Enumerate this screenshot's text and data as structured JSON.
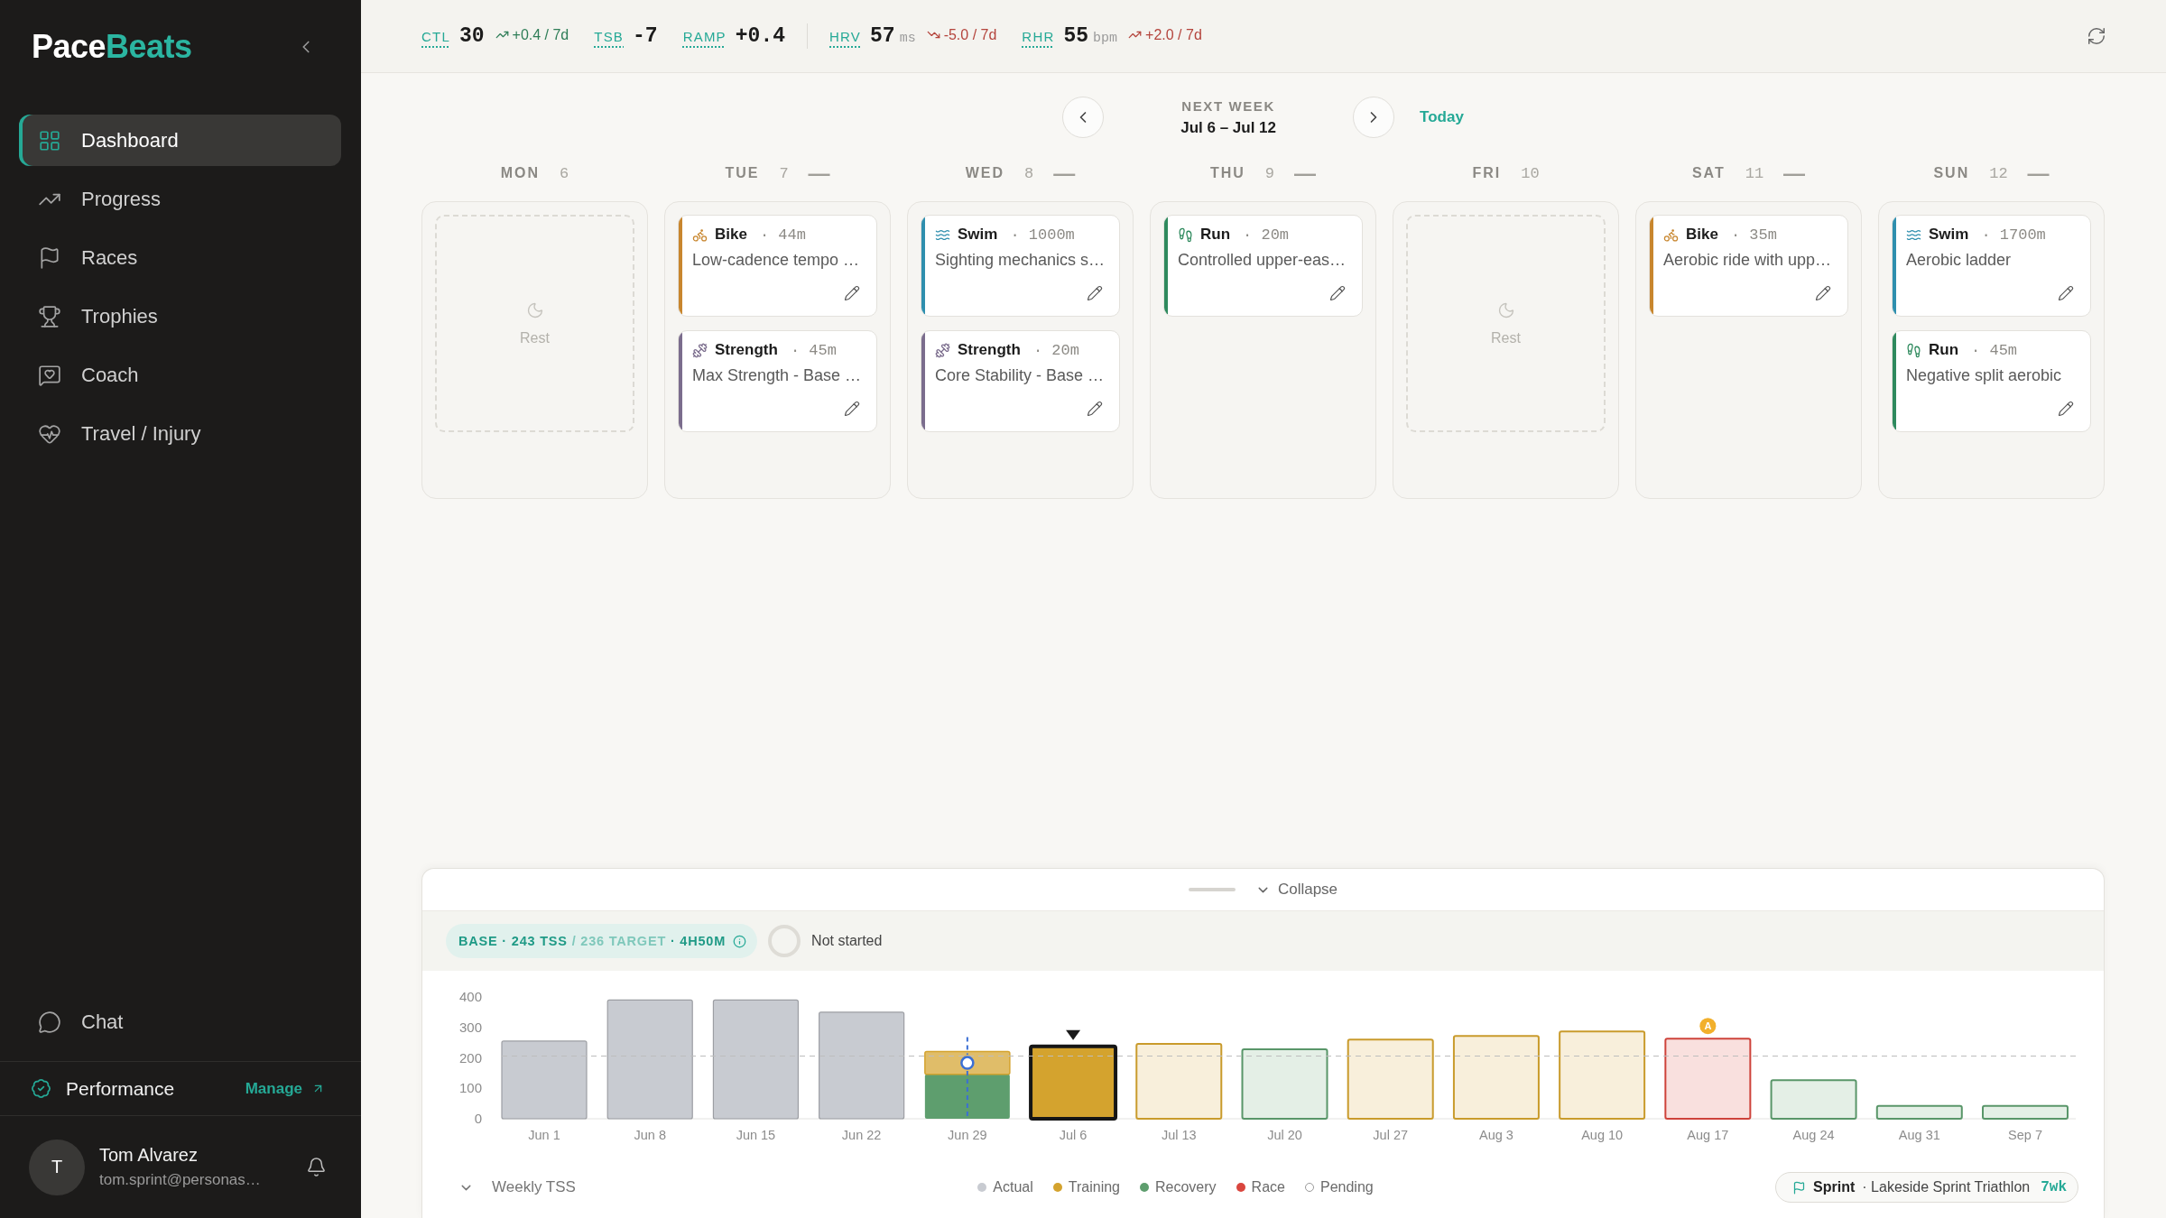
{
  "sidebar": {
    "logo": {
      "primary": "Pace",
      "accent": "Beats"
    },
    "nav_items": [
      {
        "label": "Dashboard",
        "selected": true
      },
      {
        "label": "Progress",
        "selected": false
      },
      {
        "label": "Races",
        "selected": false
      },
      {
        "label": "Trophies",
        "selected": false
      },
      {
        "label": "Coach",
        "selected": false
      },
      {
        "label": "Travel / Injury",
        "selected": false
      }
    ],
    "chat": {
      "label": "Chat"
    },
    "plan": {
      "label": "Performance",
      "action": "Manage"
    },
    "user": {
      "initial": "T",
      "name": "Tom Alvarez",
      "email": "tom.sprint@personas…"
    }
  },
  "top_bar": {
    "load_metrics": [
      {
        "label": "CTL",
        "value": "30",
        "delta": "+0.4 / 7d",
        "rising": true,
        "favorable": true
      },
      {
        "label": "TSB",
        "value": "-7"
      },
      {
        "label": "RAMP",
        "value": "+0.4"
      }
    ],
    "wellness_metrics": [
      {
        "label": "HRV",
        "value": "57",
        "unit": "ms",
        "delta": "-5.0 / 7d",
        "rising": false,
        "favorable": false
      },
      {
        "label": "RHR",
        "value": "55",
        "unit": "bpm",
        "delta": "+2.0 / 7d",
        "rising": true,
        "favorable": false
      }
    ]
  },
  "week_nav": {
    "caption": "NEXT WEEK",
    "range": "Jul 6 – Jul 12",
    "today_label": "Today"
  },
  "days": [
    {
      "weekday": "MON",
      "date": "6",
      "rest": {
        "label": "Rest"
      }
    },
    {
      "weekday": "TUE",
      "date": "7",
      "load": "—",
      "workouts": [
        {
          "kind": "bike",
          "color": "#c8862e",
          "sport": "Bike",
          "duration": "· 44m",
          "title": "Low-cadence tempo …"
        },
        {
          "kind": "strength",
          "color": "#7b6d8d",
          "sport": "Strength",
          "duration": "· 45m",
          "title": "Max Strength - Base …"
        }
      ]
    },
    {
      "weekday": "WED",
      "date": "8",
      "load": "—",
      "workouts": [
        {
          "kind": "swim",
          "color": "#2f8fae",
          "sport": "Swim",
          "duration": "· 1000m",
          "title": "Sighting mechanics s…"
        },
        {
          "kind": "strength",
          "color": "#7b6d8d",
          "sport": "Strength",
          "duration": "· 20m",
          "title": "Core Stability - Base …"
        }
      ]
    },
    {
      "weekday": "THU",
      "date": "9",
      "load": "—",
      "workouts": [
        {
          "kind": "run",
          "color": "#2f8a5e",
          "sport": "Run",
          "duration": "· 20m",
          "title": "Controlled upper-eas…"
        }
      ]
    },
    {
      "weekday": "FRI",
      "date": "10",
      "rest": {
        "label": "Rest"
      }
    },
    {
      "weekday": "SAT",
      "date": "11",
      "load": "—",
      "workouts": [
        {
          "kind": "bike",
          "color": "#c8862e",
          "sport": "Bike",
          "duration": "· 35m",
          "title": "Aerobic ride with upp…"
        }
      ]
    },
    {
      "weekday": "SUN",
      "date": "12",
      "load": "—",
      "workouts": [
        {
          "kind": "swim",
          "color": "#2f8fae",
          "sport": "Swim",
          "duration": "· 1700m",
          "title": "Aerobic ladder"
        },
        {
          "kind": "run",
          "color": "#2f8a5e",
          "sport": "Run",
          "duration": "· 45m",
          "title": "Negative split aerobic"
        }
      ]
    }
  ],
  "weekly_panel": {
    "collapse_label": "Collapse",
    "phase_summary": {
      "phase": "BASE · 243 TSS",
      "target": "/ 236 TARGET",
      "duration": "· 4H50M"
    },
    "status": {
      "label": "Not started"
    },
    "chart_data": {
      "type": "bar",
      "stacked": true,
      "categories": [
        "Jun 1",
        "Jun 8",
        "Jun 15",
        "Jun 22",
        "Jun 29",
        "Jul 6",
        "Jul 13",
        "Jul 20",
        "Jul 27",
        "Aug 3",
        "Aug 10",
        "Aug 17",
        "Aug 24",
        "Aug 31",
        "Sep 7"
      ],
      "series": [
        {
          "name": "Actual",
          "color": "#c8cbd1",
          "values": [
            255,
            390,
            390,
            350,
            0,
            0,
            0,
            0,
            0,
            0,
            0,
            0,
            0,
            0,
            0
          ]
        },
        {
          "name": "Training",
          "color": "#d4a32e",
          "values": [
            0,
            0,
            0,
            0,
            75,
            238,
            246,
            0,
            260,
            272,
            287,
            0,
            0,
            0,
            0
          ]
        },
        {
          "name": "Recovery",
          "color": "#5e9e6e",
          "values": [
            0,
            0,
            0,
            0,
            146,
            0,
            0,
            228,
            0,
            0,
            0,
            0,
            127,
            42,
            42
          ]
        },
        {
          "name": "Race",
          "color": "#d9463e",
          "values": [
            0,
            0,
            0,
            0,
            0,
            0,
            0,
            0,
            0,
            0,
            0,
            263,
            0,
            0,
            0
          ]
        }
      ],
      "ylim": [
        0,
        400
      ],
      "yticks": [
        0,
        100,
        200,
        300,
        400
      ],
      "ref_lines": [
        {
          "axis": "y",
          "value": 206
        },
        {
          "axis": "x",
          "value": "Jun 29"
        }
      ],
      "annotations": [
        {
          "text": "A",
          "x": "Aug 17",
          "y": 263
        }
      ]
    },
    "weeks": [
      {
        "kind": "done"
      },
      {
        "kind": "done"
      },
      {
        "kind": "done"
      },
      {
        "kind": "done"
      },
      {
        "kind": "current"
      },
      {
        "kind": "selected"
      },
      {
        "kind": "planned"
      },
      {
        "kind": "planned"
      },
      {
        "kind": "planned"
      },
      {
        "kind": "planned"
      },
      {
        "kind": "planned"
      },
      {
        "kind": "planned"
      },
      {
        "kind": "planned"
      },
      {
        "kind": "planned"
      },
      {
        "kind": "planned"
      }
    ],
    "toggle_label": "Weekly TSS",
    "pending_label": "Pending",
    "race": {
      "type": "Sprint",
      "name": "· Lakeside Sprint Triathlon",
      "countdown": "7wk"
    }
  }
}
